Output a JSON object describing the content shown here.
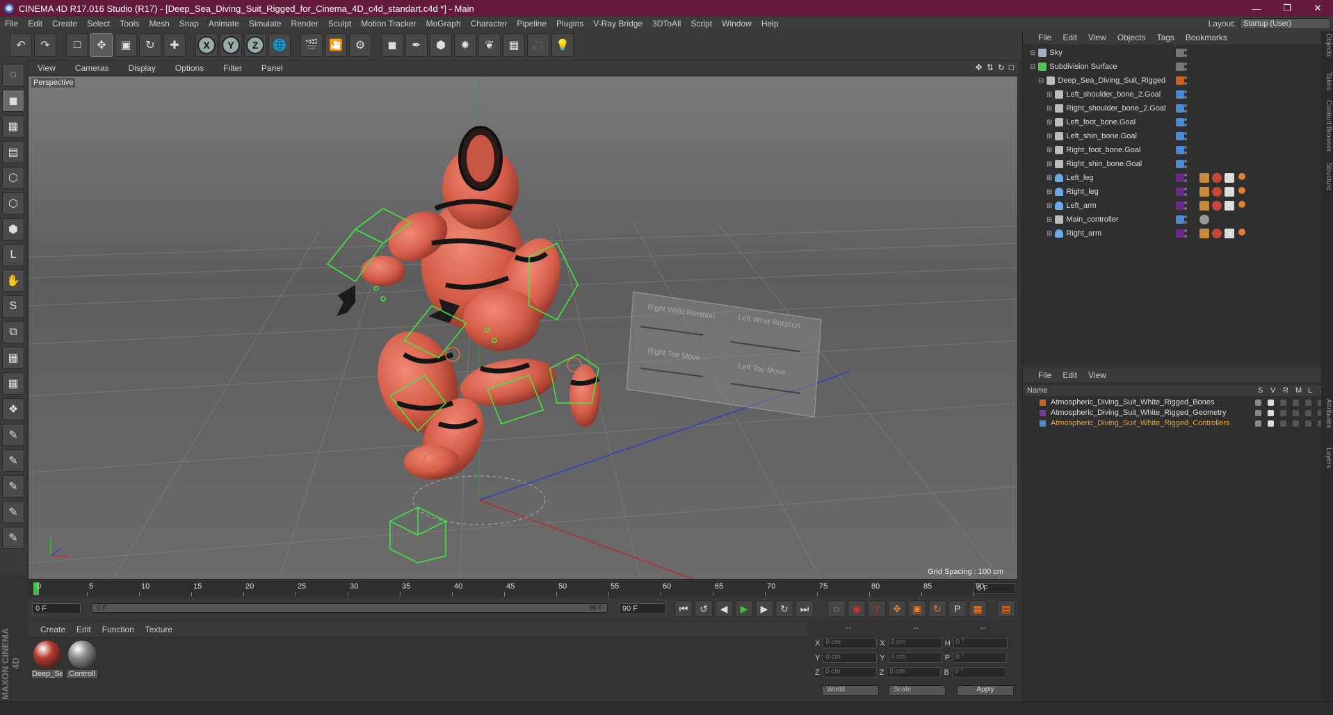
{
  "window": {
    "title": "CINEMA 4D R17.016 Studio (R17) - [Deep_Sea_Diving_Suit_Rigged_for_Cinema_4D_c4d_standart.c4d *] - Main"
  },
  "menu": [
    "File",
    "Edit",
    "Create",
    "Select",
    "Tools",
    "Mesh",
    "Snap",
    "Animate",
    "Simulate",
    "Render",
    "Sculpt",
    "Motion Tracker",
    "MoGraph",
    "Character",
    "Pipeline",
    "Plugins",
    "V-Ray Bridge",
    "3DToAll",
    "Script",
    "Window",
    "Help"
  ],
  "layout": {
    "label": "Layout:",
    "value": "Startup (User)"
  },
  "viewport": {
    "menu": [
      "View",
      "Cameras",
      "Display",
      "Options",
      "Filter",
      "Panel"
    ],
    "label": "Perspective",
    "grid_spacing": "Grid Spacing : 100 cm",
    "overlay_labels": [
      "Right Wrist Rotation",
      "Left Wrist Rotation",
      "Right Toe Move",
      "Left Toe Move"
    ]
  },
  "timeline": {
    "ticks": [
      "0",
      "5",
      "10",
      "15",
      "20",
      "25",
      "30",
      "35",
      "40",
      "45",
      "50",
      "55",
      "60",
      "65",
      "70",
      "75",
      "80",
      "85",
      "90"
    ],
    "current_frame": "0 F",
    "start_field": "0 F",
    "slider_start": "0 F",
    "slider_end": "90 F",
    "end_field": "90 F"
  },
  "materials": {
    "menu": [
      "Create",
      "Edit",
      "Function",
      "Texture"
    ],
    "items": [
      {
        "label": "Deep_Se",
        "color": "#b43a30"
      },
      {
        "label": "Controll",
        "color": "#8a8a8a"
      }
    ]
  },
  "coords": {
    "headers": [
      "--",
      "--",
      "--"
    ],
    "rows": [
      {
        "a": "X",
        "av": "0 cm",
        "b": "X",
        "bv": "0 cm",
        "c": "H",
        "cv": "0 °"
      },
      {
        "a": "Y",
        "av": "0 cm",
        "b": "Y",
        "bv": "0 cm",
        "c": "P",
        "cv": "0 °"
      },
      {
        "a": "Z",
        "av": "0 cm",
        "b": "Z",
        "bv": "0 cm",
        "c": "B",
        "cv": "0 °"
      }
    ],
    "world": "World",
    "scale": "Scale",
    "apply": "Apply"
  },
  "objects": {
    "menu": [
      "File",
      "Edit",
      "View",
      "Objects",
      "Tags",
      "Bookmarks"
    ],
    "rows": [
      {
        "name": "Sky",
        "indent": 0,
        "icon": "sky-icon",
        "color": "#9bb0c8",
        "tag": "#777"
      },
      {
        "name": "Subdivision Surface",
        "indent": 0,
        "icon": "subdivision-icon",
        "color": "#53c35a",
        "tag": "#777"
      },
      {
        "name": "Deep_Sea_Diving_Suit_Rigged",
        "indent": 1,
        "icon": "null-icon",
        "color": "#bbbbbb",
        "tag": "#d06020"
      },
      {
        "name": "Left_shoulder_bone_2.Goal",
        "indent": 2,
        "icon": "null-icon",
        "color": "#bbbbbb",
        "tag": "#4a8ad8"
      },
      {
        "name": "Right_shoulder_bone_2.Goal",
        "indent": 2,
        "icon": "null-icon",
        "color": "#bbbbbb",
        "tag": "#4a8ad8"
      },
      {
        "name": "Left_foot_bone.Goal",
        "indent": 2,
        "icon": "null-icon",
        "color": "#bbbbbb",
        "tag": "#4a8ad8"
      },
      {
        "name": "Left_shin_bone.Goal",
        "indent": 2,
        "icon": "null-icon",
        "color": "#bbbbbb",
        "tag": "#4a8ad8"
      },
      {
        "name": "Right_foot_bone.Goal",
        "indent": 2,
        "icon": "null-icon",
        "color": "#bbbbbb",
        "tag": "#4a8ad8"
      },
      {
        "name": "Right_shin_bone.Goal",
        "indent": 2,
        "icon": "null-icon",
        "color": "#bbbbbb",
        "tag": "#4a8ad8"
      },
      {
        "name": "Left_leg",
        "indent": 2,
        "icon": "joint-icon",
        "color": "#6aa8e8",
        "tag": "#6a2a8a"
      },
      {
        "name": "Right_leg",
        "indent": 2,
        "icon": "joint-icon",
        "color": "#6aa8e8",
        "tag": "#6a2a8a"
      },
      {
        "name": "Left_arm",
        "indent": 2,
        "icon": "joint-icon",
        "color": "#6aa8e8",
        "tag": "#6a2a8a"
      },
      {
        "name": "Main_controller",
        "indent": 2,
        "icon": "null-icon",
        "color": "#bbbbbb",
        "tag": "#4a8ad8"
      },
      {
        "name": "Right_arm",
        "indent": 2,
        "icon": "joint-icon",
        "color": "#6aa8e8",
        "tag": "#6a2a8a"
      }
    ]
  },
  "layers": {
    "menu": [
      "File",
      "Edit",
      "View"
    ],
    "columns": [
      "Name",
      "S",
      "V",
      "R",
      "M",
      "L",
      "A"
    ],
    "rows": [
      {
        "name": "Atmospheric_Diving_Suit_White_Rigged_Bones",
        "color": "#d06020",
        "text_color": "#dddddd"
      },
      {
        "name": "Atmospheric_Diving_Suit_White_Rigged_Geometry",
        "color": "#7a3a9a",
        "text_color": "#dddddd"
      },
      {
        "name": "Atmospheric_Diving_Suit_White_Rigged_Controllers",
        "color": "#4a8ad8",
        "text_color": "#f0a030"
      }
    ]
  },
  "side_tabs": [
    "Objects",
    "Takes",
    "Content Browser",
    "Structure",
    "Attributes",
    "Layers"
  ]
}
